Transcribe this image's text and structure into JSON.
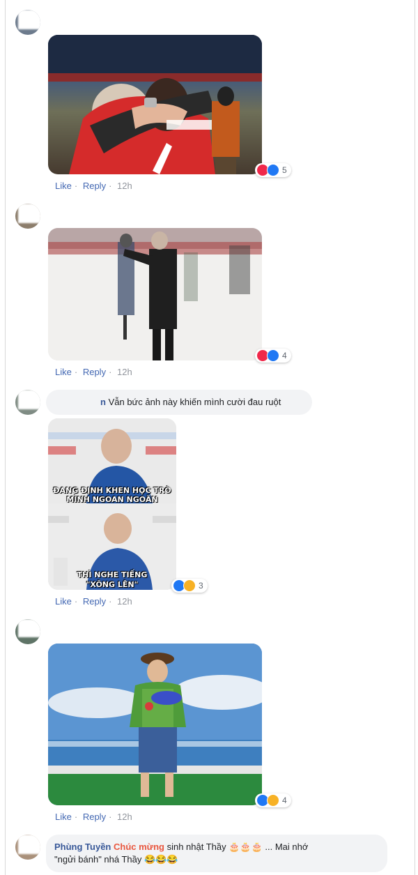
{
  "actions": {
    "like": "Like",
    "dot": "·",
    "reply": "Reply"
  },
  "comments": [
    {
      "time": "12h",
      "reaction_count": "5",
      "reactions": [
        "love-icon",
        "like-icon"
      ]
    },
    {
      "time": "12h",
      "reaction_count": "4",
      "reactions": [
        "love-icon",
        "like-icon"
      ]
    },
    {
      "author_visible": "n",
      "text": "Vẫn bức ảnh này khiến mình cười đau ruột",
      "meme_top": "ĐANG ĐỊNH KHEN HỌC TRÒ MÌNH NGOAN NGOÃN",
      "meme_bottom_1": "THÌ NGHE TIẾNG",
      "meme_bottom_2": "\"XÔNG LÊN\"",
      "time": "12h",
      "reaction_count": "3",
      "reactions": [
        "like-icon",
        "haha-icon"
      ]
    },
    {
      "time": "12h",
      "reaction_count": "4",
      "reactions": [
        "like-icon",
        "haha-icon"
      ]
    },
    {
      "author": "Phùng Tuyền",
      "text_highlight": "Chúc mừng",
      "text_line1": " sinh nhật Thầy 🎂🎂🎂 ... Mai nhớ",
      "text_line2": "\"ngửi bánh\" nhá Thầy 😂😂😂"
    }
  ]
}
